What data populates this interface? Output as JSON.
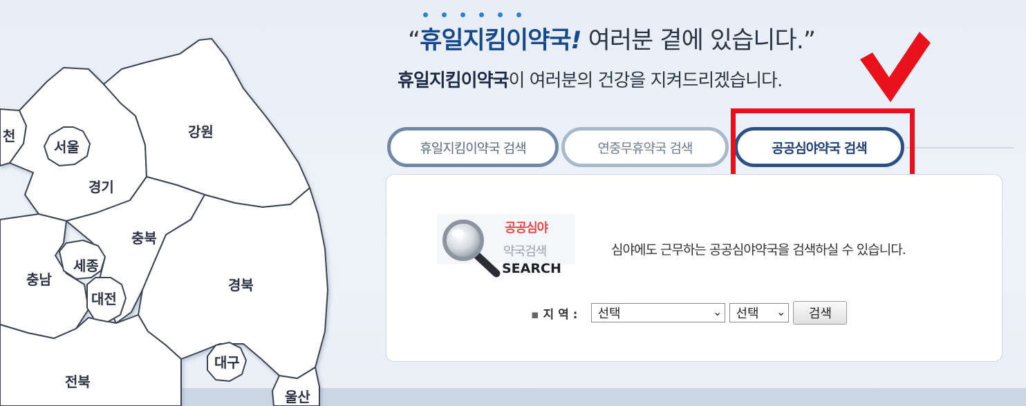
{
  "header": {
    "quote_open": "“",
    "brand": "휴일지킴이약국",
    "bang": "!",
    "headline_rest": " 여러분 곁에 있습니다.",
    "quote_close": "”",
    "sub_brand": "휴일지킴이약국",
    "sub_rest": "이 여러분의 건강을 지켜드리겠습니다."
  },
  "map": {
    "regions": [
      "천",
      "서울",
      "경기",
      "강원",
      "충북",
      "세종",
      "충남",
      "대전",
      "경북",
      "전북",
      "대구",
      "울산"
    ]
  },
  "tabs": [
    {
      "label": "휴일지킴이약국 검색"
    },
    {
      "label": "연중무휴약국 검색"
    },
    {
      "label": "공공심야약국 검색",
      "active": true
    }
  ],
  "panel": {
    "graphic_line1": "공공심야",
    "graphic_line2": "약국검색",
    "graphic_line3": "SEARCH",
    "description": "심야에도 근무하는 공공심야약국을 검색하실 수 있습니다.",
    "region_bullet": "▪",
    "region_label": "지 역 :",
    "select1_value": "선택",
    "select2_value": "선택",
    "caret": "⌄",
    "search_button": "검색"
  },
  "colors": {
    "highlight": "#e8111c",
    "brand": "#18488c",
    "active_tab_border": "#2c4f86"
  }
}
